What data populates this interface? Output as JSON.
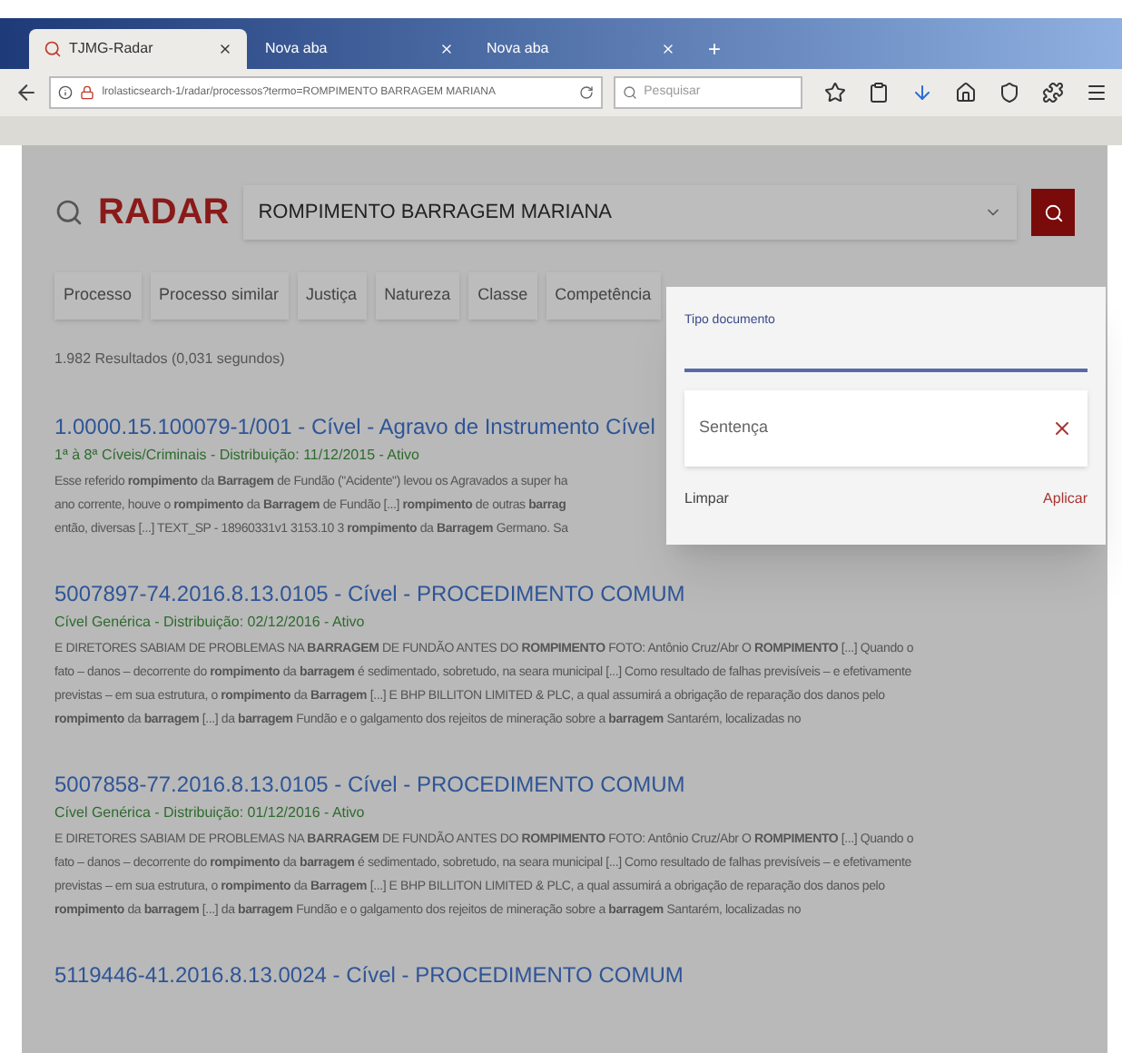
{
  "browser": {
    "tabs": [
      {
        "label": "TJMG-Radar",
        "selected": true
      },
      {
        "label": "Nova aba",
        "selected": false
      },
      {
        "label": "Nova aba",
        "selected": false
      }
    ],
    "new_tab": "+",
    "address": "lrolasticsearch-1/radar/processos?termo=ROMPIMENTO BARRAGEM MARIANA",
    "search_placeholder": "Pesquisar"
  },
  "app": {
    "logo": "RADAR",
    "query": "ROMPIMENTO BARRAGEM MARIANA",
    "filters": [
      "Processo",
      "Processo similar",
      "Justiça",
      "Natureza",
      "Classe",
      "Competência"
    ],
    "results_count": "1.982 Resultados (0,031 segundos)",
    "results": [
      {
        "title": "1.0000.15.100079-1/001 - Cível - Agravo de Instrumento Cível",
        "meta": "1ª à 8ª Cíveis/Criminais - Distribuição: 11/12/2015 - Ativo",
        "snippet_lines": [
          "Esse referido **rompimento** da **Barragem** de Fundão (\"Acidente\") levou os Agravados a super ha",
          "ano corrente, houve o **rompimento** da **Barragem** de Fundão [...] **rompimento** de outras **barrag**",
          "então, diversas [...] TEXT_SP - 18960331v1 3153.10 3 **rompimento** da **Barragem** Germano. Sa"
        ]
      },
      {
        "title": "5007897-74.2016.8.13.0105 - Cível - PROCEDIMENTO COMUM",
        "meta": "Cível Genérica - Distribuição: 02/12/2016 - Ativo",
        "snippet_lines": [
          "E DIRETORES SABIAM DE PROBLEMAS NA **BARRAGEM** DE FUNDÃO ANTES DO **ROMPIMENTO** FOTO: Antônio Cruz/Abr O **ROMPIMENTO** [...] Quando o",
          "fato – danos – decorrente do **rompimento** da **barragem** é sedimentado, sobretudo, na seara municipal [...] Como resultado de falhas previsíveis – e efetivamente",
          "previstas – em sua estrutura, o **rompimento** da **Barragem** [...] E BHP BILLITON LIMITED & PLC, a qual assumirá a obrigação de reparação dos danos pelo",
          "**rompimento** da **barragem** [...] da **barragem** Fundão e o galgamento dos rejeitos de mineração sobre a **barragem** Santarém, localizadas no"
        ]
      },
      {
        "title": "5007858-77.2016.8.13.0105 - Cível - PROCEDIMENTO COMUM",
        "meta": "Cível Genérica - Distribuição: 01/12/2016 - Ativo",
        "snippet_lines": [
          "E DIRETORES SABIAM DE PROBLEMAS NA **BARRAGEM** DE FUNDÃO ANTES DO **ROMPIMENTO** FOTO: Antônio Cruz/Abr O **ROMPIMENTO** [...] Quando o",
          "fato – danos – decorrente do **rompimento** da **barragem** é sedimentado, sobretudo, na seara municipal [...] Como resultado de falhas previsíveis – e efetivamente",
          "previstas – em sua estrutura, o **rompimento** da **Barragem** [...] E BHP BILLITON LIMITED & PLC, a qual assumirá a obrigação de reparação dos danos pelo",
          "**rompimento** da **barragem** [...] da **barragem** Fundão e o galgamento dos rejeitos de mineração sobre a **barragem** Santarém, localizadas no"
        ]
      },
      {
        "title": "5119446-41.2016.8.13.0024 - Cível - PROCEDIMENTO COMUM"
      }
    ]
  },
  "filter_popup": {
    "label": "Tipo documento",
    "chips": [
      "Sentença"
    ],
    "clear": "Limpar",
    "apply": "Aplicar"
  }
}
